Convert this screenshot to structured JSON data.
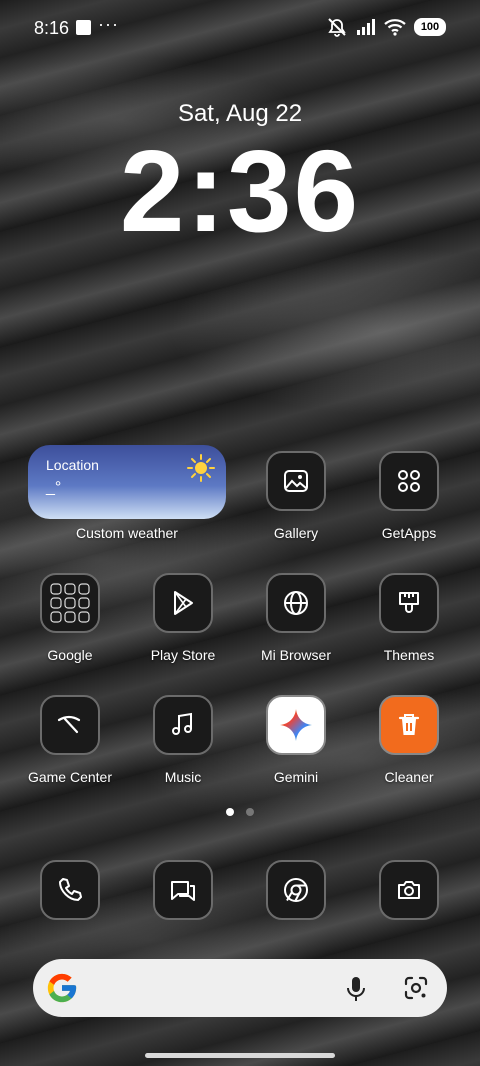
{
  "status": {
    "time": "8:16",
    "more": "···",
    "battery": "100"
  },
  "lock": {
    "date": "Sat, Aug 22",
    "time": "2:36"
  },
  "weather": {
    "location": "Location",
    "temp": "_°",
    "label": "Custom weather"
  },
  "apps": [
    {
      "label": "Gallery",
      "icon": "gallery-icon"
    },
    {
      "label": "GetApps",
      "icon": "getapps-icon"
    },
    {
      "label": "Google",
      "icon": "google-folder-icon"
    },
    {
      "label": "Play Store",
      "icon": "play-store-icon"
    },
    {
      "label": "Mi Browser",
      "icon": "browser-icon"
    },
    {
      "label": "Themes",
      "icon": "themes-icon"
    },
    {
      "label": "Game Center",
      "icon": "game-center-icon"
    },
    {
      "label": "Music",
      "icon": "music-icon"
    },
    {
      "label": "Gemini",
      "icon": "gemini-icon"
    },
    {
      "label": "Cleaner",
      "icon": "cleaner-icon"
    }
  ],
  "dock": [
    {
      "icon": "phone-icon"
    },
    {
      "icon": "messages-icon"
    },
    {
      "icon": "chrome-icon"
    },
    {
      "icon": "camera-icon"
    }
  ],
  "pager": {
    "pages": 2,
    "current": 1
  },
  "colors": {
    "cleaner": "#f26b1d",
    "weather_top": "#3d4f9b",
    "weather_bottom": "#cfe0f5",
    "search_bg": "#efefef"
  }
}
